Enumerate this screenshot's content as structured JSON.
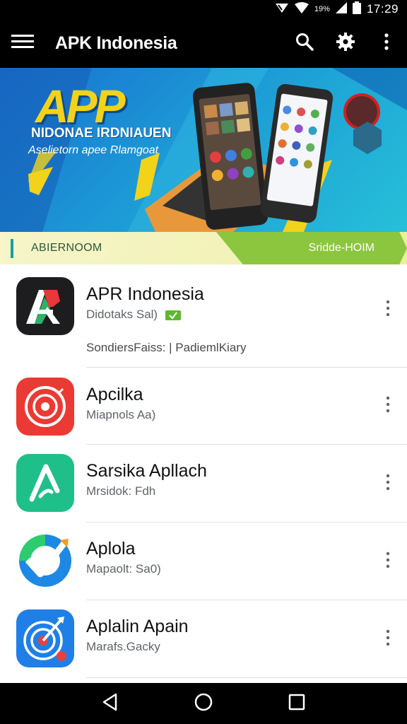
{
  "status_bar": {
    "battery_percent": "19%",
    "time": "17:29"
  },
  "app_bar": {
    "title": "APK Indonesia",
    "icons": [
      "menu-icon",
      "search-icon",
      "gear-icon",
      "more-vert-icon"
    ]
  },
  "banner": {
    "logo_text": "APP",
    "headline": "NIDONAE IRDNIAUEN",
    "subtitle": "Aselietorn apee Rlamgoat"
  },
  "section": {
    "left_label": "ABIERNOOM",
    "right_label": "Sridde-HOIM"
  },
  "apps": [
    {
      "name": "APR Indonesia",
      "meta": "Didotaks Sal)",
      "extra": "SondiersFaiss: | PadiemlKiary",
      "verified": true,
      "icon": "apr-logo-icon"
    },
    {
      "name": "Apcilka",
      "meta": "Miapnols Aa)",
      "icon": "target-icon"
    },
    {
      "name": "Sarsika Apllach",
      "meta": "Mrsidok: Fdh",
      "icon": "a-arrow-icon"
    },
    {
      "name": "Aplola",
      "meta": "Mapaolt: Sa0)",
      "icon": "checkmark-icon"
    },
    {
      "name": "Aplalin Apain",
      "meta": "Marafs.Gacky",
      "icon": "radar-icon"
    }
  ],
  "colors": {
    "bar_bg": "#000000",
    "banner_blue": "#1c9ad6",
    "accent_yellow": "#f3d21a",
    "strip_green": "#8bc63e",
    "verified_green": "#5cb82e"
  },
  "nav_bar": {
    "icons": [
      "back-icon",
      "home-icon",
      "recents-icon"
    ]
  }
}
